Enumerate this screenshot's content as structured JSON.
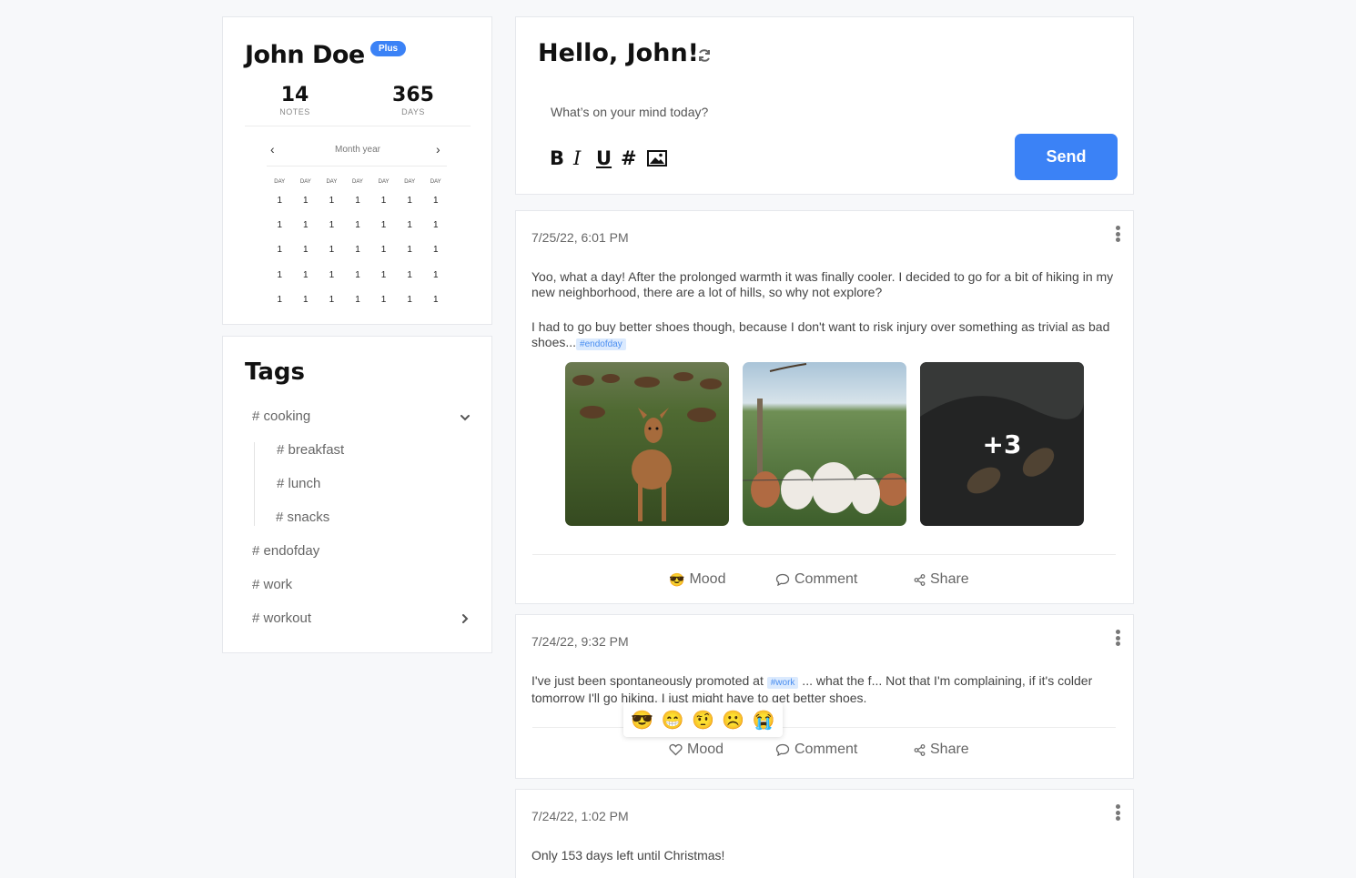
{
  "profile": {
    "name": "John Doe",
    "badge": "Plus",
    "stats": [
      {
        "value": "14",
        "label": "NOTES"
      },
      {
        "value": "365",
        "label": "DAYS"
      }
    ],
    "calendar": {
      "title": "Month year",
      "prev": "‹",
      "next": "›",
      "weekdays": [
        "DAY",
        "DAY",
        "DAY",
        "DAY",
        "DAY",
        "DAY",
        "DAY"
      ],
      "rows": [
        [
          "1",
          "1",
          "1",
          "1",
          "1",
          "1",
          "1"
        ],
        [
          "1",
          "1",
          "1",
          "1",
          "1",
          "1",
          "1"
        ],
        [
          "1",
          "1",
          "1",
          "1",
          "1",
          "1",
          "1"
        ],
        [
          "1",
          "1",
          "1",
          "1",
          "1",
          "1",
          "1"
        ],
        [
          "1",
          "1",
          "1",
          "1",
          "1",
          "1",
          "1"
        ]
      ]
    }
  },
  "tags": {
    "title": "Tags",
    "items": [
      {
        "label": "# cooking"
      },
      {
        "label": "# breakfast"
      },
      {
        "label": "# lunch"
      },
      {
        "label": "# snacks"
      },
      {
        "label": "# endofday"
      },
      {
        "label": "# work"
      },
      {
        "label": "# workout"
      }
    ]
  },
  "compose": {
    "greeting": "Hello, John!",
    "placeholder": "What’s on your mind today?",
    "tools": {
      "bold": "B",
      "italic": "I",
      "underline": "U",
      "hashtag": "#"
    },
    "send_label": "Send"
  },
  "posts": [
    {
      "date": "7/25/22, 6:01 PM",
      "para1": "Yoo, what a day! After the prolonged warmth it was finally cooler. I decided to go for a bit of hiking in my new neighborhood, there are a lot of hills, so why not explore?",
      "para2": "I had to go buy better shoes though, because I don't want to risk injury over something as trivial as bad shoes...",
      "tag": "#endofday",
      "more_images": "+3",
      "actions": {
        "mood": "Mood",
        "mood_emoji": "😎",
        "comment": "Comment",
        "share": "Share"
      }
    },
    {
      "date": "7/24/22, 9:32 PM",
      "text_before": "I've just been spontaneously promoted at",
      "tag": "#work",
      "text_after": " ... what the f... Not that I'm complaining, if it's colder tomorrow I'll go hiking, I just might have to get better shoes.",
      "emojis": [
        "😎",
        "😁",
        "🤨",
        "☹️",
        "😭"
      ],
      "actions": {
        "mood": "Mood",
        "comment": "Comment",
        "share": "Share"
      }
    },
    {
      "date": "7/24/22, 1:02 PM",
      "text": "Only 153 days left until Christmas!"
    }
  ],
  "colors": {
    "accent": "#3b82f6",
    "tag_bg": "#dbeafe",
    "background": "#f7f8fa"
  },
  "icons": [
    "refresh-icon",
    "image-icon",
    "kebab-menu-icon",
    "chevron-down-icon",
    "chevron-right-icon",
    "heart-icon",
    "comment-icon",
    "share-icon"
  ]
}
